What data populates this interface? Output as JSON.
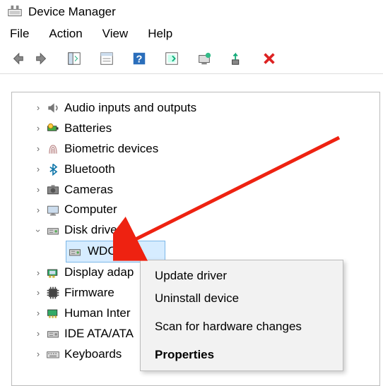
{
  "window": {
    "title": "Device Manager"
  },
  "menu": {
    "file": "File",
    "action": "Action",
    "view": "View",
    "help": "Help"
  },
  "tree": {
    "items": [
      {
        "label": "Audio inputs and outputs",
        "expanded": false
      },
      {
        "label": "Batteries",
        "expanded": false
      },
      {
        "label": "Biometric devices",
        "expanded": false
      },
      {
        "label": "Bluetooth",
        "expanded": false
      },
      {
        "label": "Cameras",
        "expanded": false
      },
      {
        "label": "Computer",
        "expanded": false
      },
      {
        "label": "Disk drives",
        "expanded": true,
        "children": [
          {
            "label": "WDC PC",
            "selected": true
          }
        ]
      },
      {
        "label": "Display adap",
        "expanded": false
      },
      {
        "label": "Firmware",
        "expanded": false
      },
      {
        "label": "Human Inter",
        "expanded": false
      },
      {
        "label": "IDE ATA/ATA",
        "expanded": false
      },
      {
        "label": "Keyboards",
        "expanded": false
      }
    ]
  },
  "context_menu": {
    "update": "Update driver",
    "uninstall": "Uninstall device",
    "scan": "Scan for hardware changes",
    "properties": "Properties"
  }
}
